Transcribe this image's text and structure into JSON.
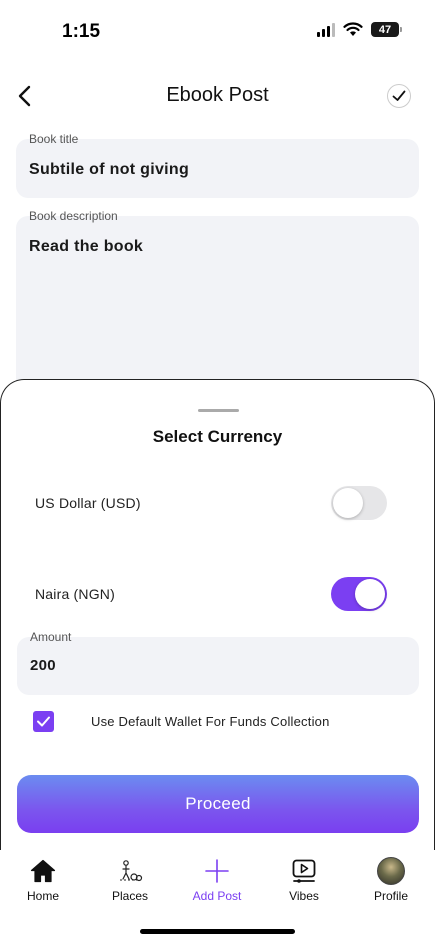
{
  "status_bar": {
    "time": "1:15",
    "battery": "47"
  },
  "header": {
    "title": "Ebook Post"
  },
  "form": {
    "title_label": "Book title",
    "title_value": "Subtile of not giving",
    "description_label": "Book description",
    "description_value": "Read the book"
  },
  "sheet": {
    "title": "Select Currency",
    "currencies": [
      {
        "label": "US Dollar (USD)",
        "enabled": false
      },
      {
        "label": "Naira (NGN)",
        "enabled": true
      }
    ],
    "amount_label": "Amount",
    "amount_value": "200",
    "wallet_checkbox_label": "Use Default Wallet For Funds Collection",
    "wallet_checked": true,
    "proceed_label": "Proceed"
  },
  "tab_bar": {
    "items": [
      {
        "label": "Home",
        "icon": "home-icon"
      },
      {
        "label": "Places",
        "icon": "places-icon"
      },
      {
        "label": "Add Post",
        "icon": "plus-icon",
        "active": true
      },
      {
        "label": "Vibes",
        "icon": "video-icon"
      },
      {
        "label": "Profile",
        "icon": "avatar"
      }
    ]
  },
  "colors": {
    "accent": "#7b3ff2",
    "field_bg": "#f2f3f7"
  }
}
